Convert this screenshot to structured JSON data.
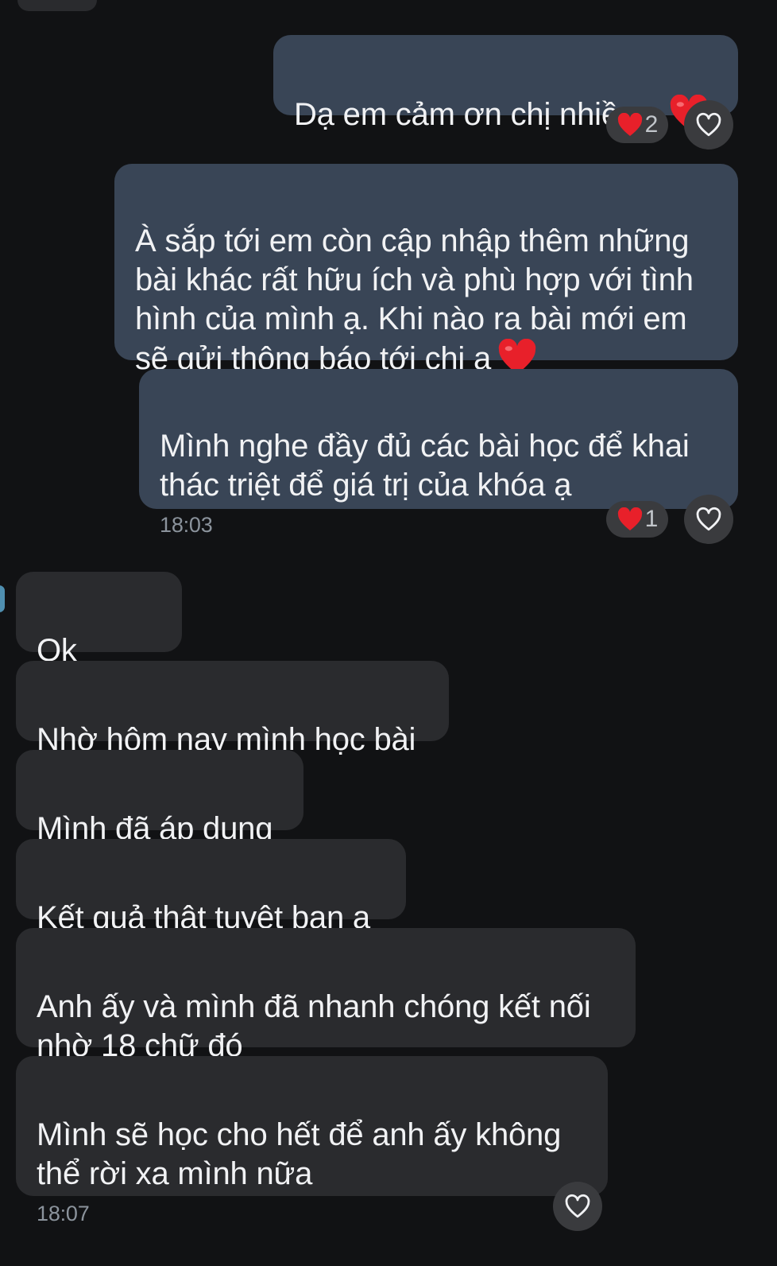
{
  "messages": [
    {
      "text": "Dạ em cảm ơn chị nhiều ạ",
      "emoji": "heart-emoji",
      "reaction_count": "2"
    },
    {
      "text": "À sắp tới em còn cập nhập thêm những\nbài khác rất hữu ích và phù hợp với tình\nhình của mình ạ. Khi nào ra bài mới em\nsẽ gửi thông báo tới chị ạ",
      "emoji": "heart-emoji"
    },
    {
      "text": "Mình nghe đầy đủ các bài học để khai\nthác triệt để giá trị của khóa ạ",
      "time": "18:03",
      "reaction_count": "1"
    },
    {
      "text": "Ok"
    },
    {
      "text": "Nhờ hôm nay mình học bài"
    },
    {
      "text": "Mình đã áp dụng"
    },
    {
      "text": "Kết quả thật tuyệt bạn ạ"
    },
    {
      "text": "Anh ấy và mình đã nhanh chóng kết nối\nnhờ 18 chữ đó"
    },
    {
      "text": "Mình sẽ học cho hết để anh ấy không\nthể rời xa mình nữa",
      "time": "18:07"
    }
  ],
  "colors": {
    "background": "#111214",
    "outgoing_bubble": "#394556",
    "incoming_bubble": "#2a2b2e",
    "reaction_heart": "#e8202a",
    "timestamp": "#8b939c"
  },
  "icons": {
    "like": "heart-outline-icon",
    "reaction": "red-heart-icon"
  }
}
